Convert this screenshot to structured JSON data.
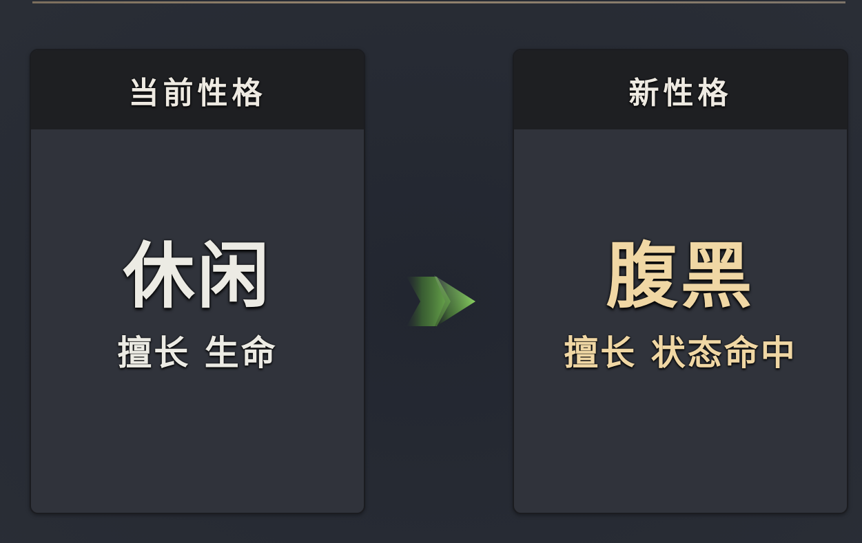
{
  "current": {
    "header": "当前性格",
    "name": "休闲",
    "desc": "擅长 生命"
  },
  "next": {
    "header": "新性格",
    "name": "腹黑",
    "desc": "擅长 状态命中"
  },
  "colors": {
    "current_text": "#ecebe4",
    "next_text": "#f0d7a4",
    "arrow": "#7bd24e"
  },
  "icons": {
    "transition": "arrow-right-icon"
  }
}
